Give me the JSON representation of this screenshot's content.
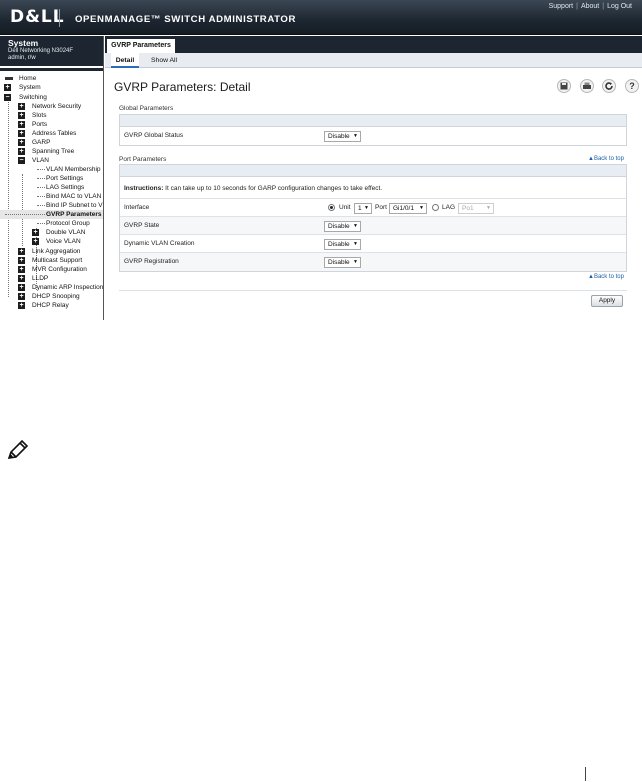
{
  "header": {
    "logo": "D&LL",
    "title": "OPENMANAGE™ SWITCH ADMINISTRATOR",
    "links": [
      "Support",
      "About",
      "Log Out"
    ]
  },
  "system": {
    "title": "System",
    "model": "Dell Networking N3024F",
    "user": "admin, r/w"
  },
  "nav": {
    "home": "Home",
    "system": "System",
    "switching": "Switching",
    "network_security": "Network Security",
    "slots": "Slots",
    "ports": "Ports",
    "address_tables": "Address Tables",
    "garp": "GARP",
    "spanning_tree": "Spanning Tree",
    "vlan": "VLAN",
    "vlan_membership": "VLAN Membership",
    "port_settings": "Port Settings",
    "lag_settings": "LAG Settings",
    "bind_mac": "Bind MAC to VLAN",
    "bind_ip": "Bind IP Subnet to VLAN",
    "gvrp_parameters": "GVRP Parameters",
    "protocol_group": "Protocol Group",
    "double_vlan": "Double VLAN",
    "voice_vlan": "Voice VLAN",
    "link_aggregation": "Link Aggregation",
    "multicast_support": "Multicast Support",
    "mvr_configuration": "MVR Configuration",
    "lldp": "LLDP",
    "dynamic_arp": "Dynamic ARP Inspection",
    "dhcp_snooping": "DHCP Snooping",
    "dhcp_relay": "DHCP Relay"
  },
  "tabs": {
    "main": "GVRP Parameters",
    "detail": "Detail",
    "show_all": "Show All"
  },
  "page": {
    "title": "GVRP Parameters: Detail",
    "global_section": "Global Parameters",
    "global_status_label": "GVRP Global Status",
    "global_status_value": "Disable",
    "port_section": "Port Parameters",
    "back_to_top": "▲Back to top",
    "instructions_bold": "Instructions:",
    "instructions_text": " It can take up to 10 seconds for GARP configuration changes to take effect.",
    "interface_label": "Interface",
    "unit_label": "Unit",
    "unit_value": "1",
    "port_label": "Port",
    "port_value": "Gi1/0/1",
    "lag_label": "LAG",
    "lag_value": "Po1",
    "gvrp_state_label": "GVRP State",
    "gvrp_state_value": "Disable",
    "dynamic_vlan_label": "Dynamic VLAN Creation",
    "dynamic_vlan_value": "Disable",
    "gvrp_registration_label": "GVRP Registration",
    "gvrp_registration_value": "Disable",
    "apply": "Apply"
  },
  "icons": {
    "save": "save-icon",
    "print": "print-icon",
    "refresh": "refresh-icon",
    "help": "help-icon"
  },
  "colors": {
    "header_bg": "#1c2530",
    "accent": "#2a6ebb",
    "link": "#1b5fa8"
  }
}
